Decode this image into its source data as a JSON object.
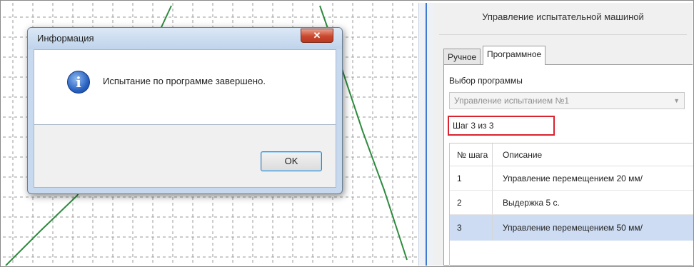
{
  "dialog": {
    "title": "Информация",
    "close_label": "✕",
    "message": "Испытание по программе завершено.",
    "ok_label": "OK",
    "icon": "info-icon"
  },
  "panel": {
    "title": "Управление испытательной машиной",
    "tabs": [
      {
        "label": "Ручное",
        "active": false
      },
      {
        "label": "Программное",
        "active": true
      }
    ],
    "program_label": "Выбор программы",
    "program_value": "Управление испытанием №1",
    "step_text": "Шаг 3 из 3",
    "table": {
      "headers": [
        "№ шага",
        "Описание"
      ],
      "rows": [
        {
          "num": "1",
          "desc": "Управление перемещением 20 мм/"
        },
        {
          "num": "2",
          "desc": "Выдержка 5 с."
        },
        {
          "num": "3",
          "desc": "Управление перемещением 50 мм/",
          "selected": true
        }
      ]
    }
  },
  "colors": {
    "grid_line": "#9a9a9a",
    "curve": "#2e8b3e",
    "highlight_border": "#d9232e",
    "selected_row": "#cddcf2"
  }
}
